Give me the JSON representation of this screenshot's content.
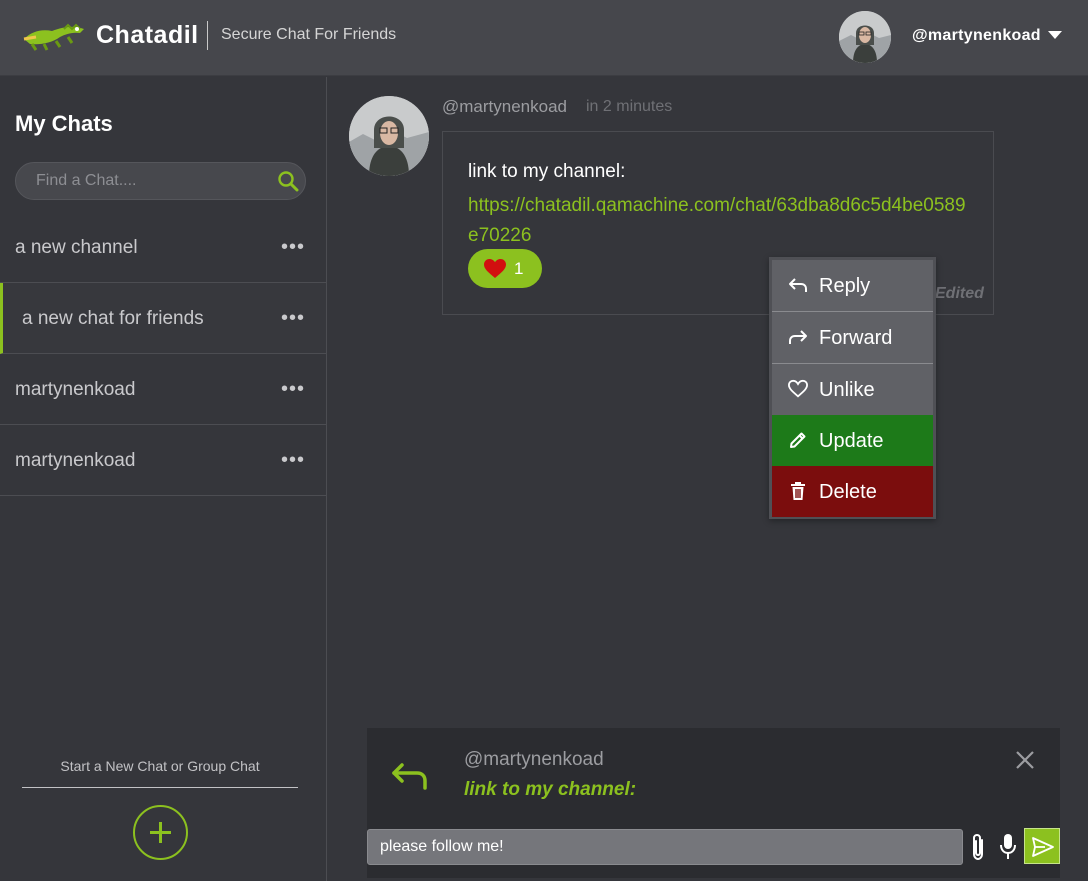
{
  "header": {
    "brand": "Chatadil",
    "tagline": "Secure Chat For Friends",
    "username": "@martynenkoad"
  },
  "sidebar": {
    "title": "My Chats",
    "search_placeholder": "Find a Chat....",
    "chats": [
      {
        "label": "a new channel",
        "more": "•••"
      },
      {
        "label": "a new chat for friends",
        "more": "•••"
      },
      {
        "label": "martynenkoad",
        "more": "•••"
      },
      {
        "label": "martynenkoad",
        "more": "•••"
      }
    ],
    "active_chat_index": 1,
    "new_chat_label": "Start a New Chat or Group Chat"
  },
  "message": {
    "author": "@martynenkoad",
    "time": "in 2 minutes",
    "text": "link to my channel:",
    "link": "https://chatadil.qamachine.com/chat/63dba8d6c5d4be0589e70226",
    "reaction_count": "1",
    "edited": "Edited"
  },
  "context_menu": {
    "reply": "Reply",
    "forward": "Forward",
    "unlike": "Unlike",
    "update": "Update",
    "delete": "Delete"
  },
  "reply": {
    "author": "@martynenkoad",
    "preview": "link to my channel:"
  },
  "composer": {
    "value": "please follow me!"
  },
  "colors": {
    "accent": "#8cc11f",
    "update": "#1d7a19",
    "delete": "#7b0d0d",
    "heart": "#d20f0f"
  }
}
